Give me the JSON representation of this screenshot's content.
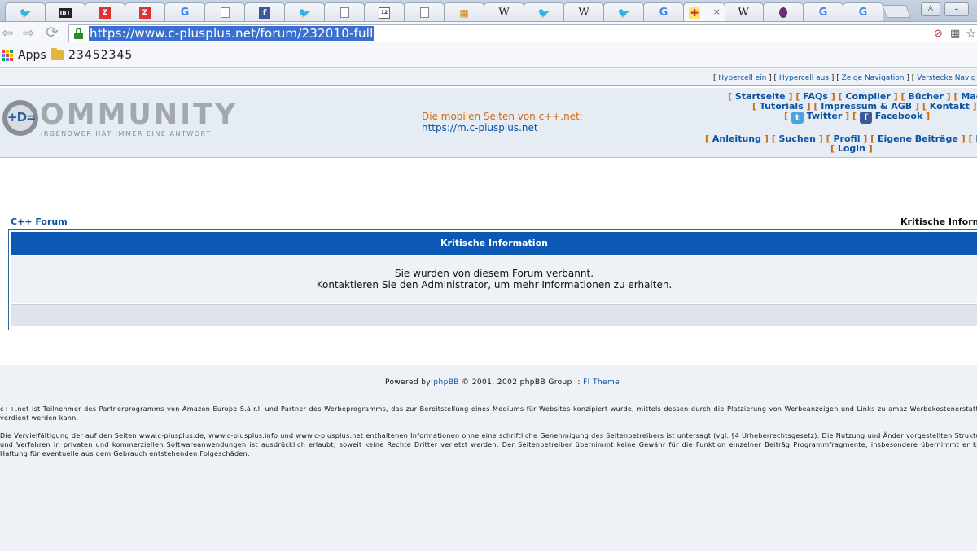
{
  "browser": {
    "tabs": [
      {
        "icon": "twitter-icon",
        "glyph": "🐦"
      },
      {
        "icon": "ibt-icon",
        "glyph": "IBT"
      },
      {
        "icon": "zdnet-icon",
        "glyph": "Z"
      },
      {
        "icon": "zdnet-icon",
        "glyph": "Z"
      },
      {
        "icon": "google-icon",
        "glyph": "G"
      },
      {
        "icon": "page-icon",
        "glyph": ""
      },
      {
        "icon": "facebook-icon",
        "glyph": "f"
      },
      {
        "icon": "twitter-icon",
        "glyph": "🐦"
      },
      {
        "icon": "page-icon",
        "glyph": ""
      },
      {
        "icon": "calendar-icon",
        "glyph": "12"
      },
      {
        "icon": "page-icon",
        "glyph": ""
      },
      {
        "icon": "image-icon",
        "glyph": "▦"
      },
      {
        "icon": "wikipedia-icon",
        "glyph": "W"
      },
      {
        "icon": "twitter-icon",
        "glyph": "🐦"
      },
      {
        "icon": "wikipedia-icon",
        "glyph": "W"
      },
      {
        "icon": "twitter-icon",
        "glyph": "🐦"
      },
      {
        "icon": "google-icon",
        "glyph": "G"
      },
      {
        "icon": "cplusplus-icon",
        "glyph": "✚",
        "active": true
      },
      {
        "icon": "wikipedia-icon",
        "glyph": "W"
      },
      {
        "icon": "tor-icon",
        "glyph": ""
      },
      {
        "icon": "google-icon",
        "glyph": "G"
      },
      {
        "icon": "google-icon",
        "glyph": "G"
      }
    ],
    "active_tab_close": "×",
    "url": "https://www.c-plusplus.net/forum/232010-full",
    "nav": {
      "back": "⇦",
      "forward": "⇨",
      "reload": "⟳"
    },
    "bookmarks": {
      "apps": "Apps",
      "folder": "23452345"
    }
  },
  "page": {
    "hyperbar": {
      "parts": [
        {
          "link": "Hypercell ein"
        },
        {
          "link": "Hypercell aus"
        },
        {
          "link": "Zeige Navigation"
        },
        {
          "link": "Verstecke Navig"
        }
      ]
    },
    "logo": {
      "mark": "+D=",
      "word": "OMMUNITY",
      "tagline": "Irgendwer hat immer eine Antwort"
    },
    "mobile": {
      "line1": "Die mobilen Seiten von c++.net:",
      "line2": "https://m.c-plusplus.net"
    },
    "nav_row1": [
      "Startseite",
      "FAQs",
      "Compiler",
      "Bücher",
      "Magazin"
    ],
    "nav_row2": [
      "Tutorials",
      "Impressum & AGB",
      "Kontakt"
    ],
    "nav_social": [
      "Twitter",
      "Facebook"
    ],
    "nav_row4": [
      "Anleitung",
      "Suchen",
      "Profil",
      "Eigene Beiträge",
      "Registriere"
    ],
    "nav_row5": [
      "Login"
    ],
    "breadcrumb": {
      "left": "C++ Forum",
      "right": "Kritische Informa"
    },
    "info": {
      "title": "Kritische Information",
      "line1": "Sie wurden von diesem Forum verbannt.",
      "line2": "Kontaktieren Sie den Administrator, um mehr Informationen zu erhalten."
    },
    "footer": {
      "powered_prefix": "Powered by",
      "phpbb": "phpBB",
      "powered_mid": "© 2001, 2002 phpBB Group ::",
      "theme": "FI Theme",
      "legal1": "c++.net ist Teilnehmer des Partnerprogramms von Amazon Europe S.à.r.l. und Partner des Werbeprogramms, das zur Bereitstellung eines Mediums für Websites konzipiert wurde, mittels dessen durch die Platzierung von Werbeanzeigen und Links zu amaz Werbekostenerstattung verdient werden kann.",
      "legal2": "Die Vervielfältigung der auf den Seiten www.c-plusplus.de, www.c-plusplus.info und www.c-plusplus.net enthaltenen Informationen ohne eine schriftliche Genehmigung des Seitenbetreibers ist untersagt (vgl. §4 Urheberrechtsgesetz). Die Nutzung und Änder vorgestellten Strukturen und Verfahren in privaten und kommerziellen Softwareanwendungen ist ausdrücklich erlaubt, soweit keine Rechte Dritter verletzt werden. Der Seitenbetreiber übernimmt keine Gewähr für die Funktion einzelner Beiträg Programmfragmente, insbesondere übernimmt er keine Haftung für eventuelle aus dem Gebrauch entstehenden Folgeschäden."
    }
  },
  "colors": {
    "link": "#0c52a2",
    "accent_orange": "#d36a0a",
    "header_blue": "#0b59b4",
    "secure_green": "#2b8a2b"
  }
}
